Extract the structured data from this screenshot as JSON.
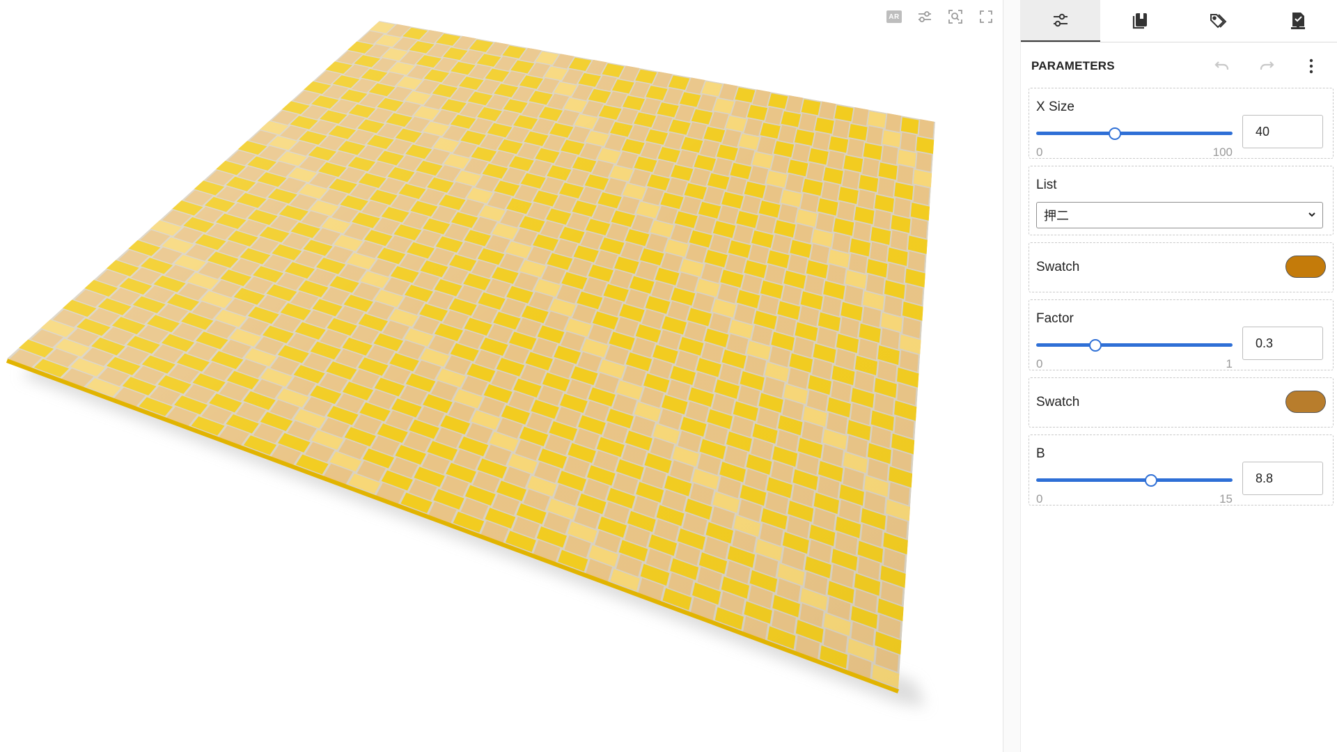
{
  "viewport": {
    "tools": [
      {
        "name": "ar-icon",
        "label": "AR"
      },
      {
        "name": "sliders-icon"
      },
      {
        "name": "zoom-fit-icon"
      },
      {
        "name": "fullscreen-icon"
      }
    ],
    "fabric_colors": {
      "weft_light": "#f7d777",
      "weft_yellow": "#f2cc1f",
      "warp_tan": "#e9c486",
      "shadow": "#cfcfcf"
    }
  },
  "panel": {
    "tabs": [
      {
        "name": "tab-parameters",
        "icon": "sliders-icon",
        "active": true
      },
      {
        "name": "tab-library",
        "icon": "library-icon",
        "active": false
      },
      {
        "name": "tab-tags",
        "icon": "tags-icon",
        "active": false
      },
      {
        "name": "tab-export",
        "icon": "download-icon",
        "active": false
      }
    ],
    "title": "PARAMETERS",
    "header_buttons": [
      "undo-icon",
      "redo-icon",
      "more-vertical-icon"
    ],
    "params": {
      "x_size": {
        "label": "X Size",
        "min": "0",
        "max": "100",
        "value": "40",
        "fraction": 0.4
      },
      "list": {
        "label": "List",
        "selected": "押二"
      },
      "swatch1": {
        "label": "Swatch",
        "color": "#c47b0a"
      },
      "factor": {
        "label": "Factor",
        "min": "0",
        "max": "1",
        "value": "0.3",
        "fraction": 0.3
      },
      "swatch2": {
        "label": "Swatch",
        "color": "#b87d2c"
      },
      "b": {
        "label": "B",
        "min": "0",
        "max": "15",
        "value": "8.8",
        "fraction": 0.5867
      }
    }
  }
}
